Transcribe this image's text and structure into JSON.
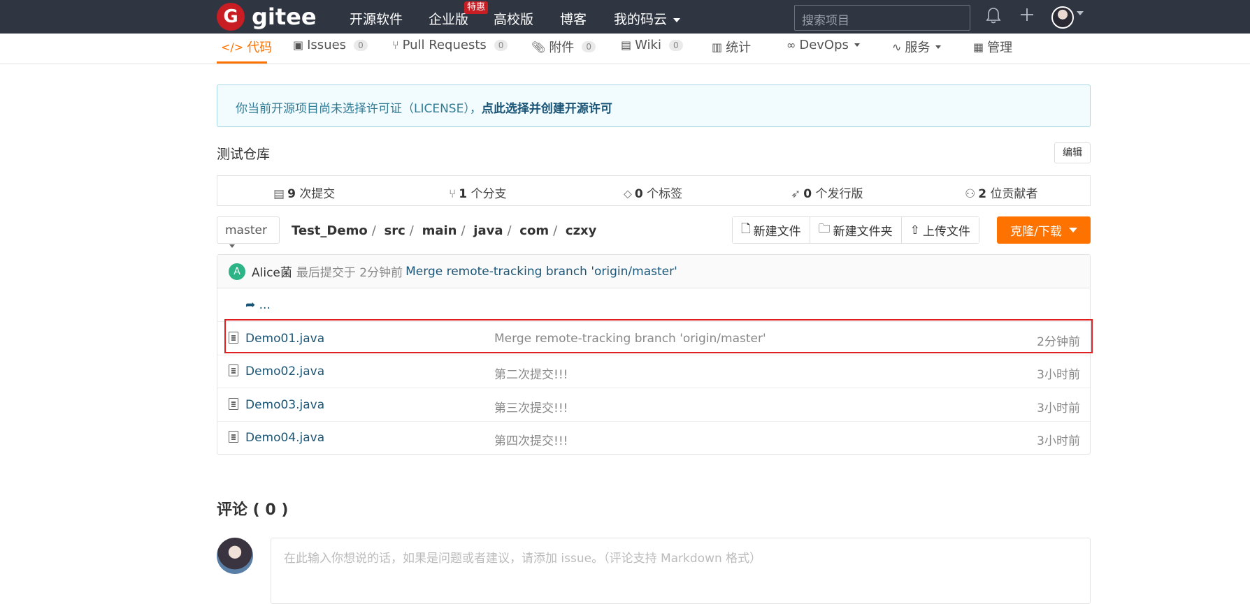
{
  "brand": {
    "logo_letter": "G",
    "name": "gitee"
  },
  "topnav": {
    "items": [
      "开源软件",
      "企业版",
      "高校版",
      "博客",
      "我的码云"
    ],
    "badge": "特惠",
    "search_placeholder": "搜索项目"
  },
  "tabs": [
    {
      "label": "代码",
      "icon": "code-icon",
      "active": true
    },
    {
      "label": "Issues",
      "count": "0",
      "icon": "issue-icon"
    },
    {
      "label": "Pull Requests",
      "count": "0",
      "icon": "pull-request-icon"
    },
    {
      "label": "附件",
      "count": "0",
      "icon": "paperclip-icon"
    },
    {
      "label": "Wiki",
      "count": "0",
      "icon": "book-icon"
    },
    {
      "label": "统计",
      "icon": "bar-chart-icon"
    },
    {
      "label": "DevOps",
      "icon": "infinity-icon"
    },
    {
      "label": "服务",
      "icon": "pulse-icon"
    },
    {
      "label": "管理",
      "icon": "settings-doc-icon"
    }
  ],
  "notice": {
    "text": "你当前开源项目尚未选择许可证（LICENSE），",
    "link": "点此选择并创建开源许可"
  },
  "repo": {
    "description": "测试仓库",
    "edit_label": "编辑"
  },
  "stats": [
    {
      "num": "9",
      "label": "次提交",
      "icon": "commit-icon"
    },
    {
      "num": "1",
      "label": "个分支",
      "icon": "branch-icon"
    },
    {
      "num": "0",
      "label": "个标签",
      "icon": "tag-icon"
    },
    {
      "num": "0",
      "label": "个发行版",
      "icon": "release-icon"
    },
    {
      "num": "2",
      "label": "位贡献者",
      "icon": "contributors-icon"
    }
  ],
  "branch": {
    "name": "master"
  },
  "path": [
    "Test_Demo",
    "src",
    "main",
    "java",
    "com",
    "czxy"
  ],
  "actions": {
    "new_file": "新建文件",
    "new_folder": "新建文件夹",
    "upload": "上传文件",
    "clone": "克隆/下载"
  },
  "last_commit": {
    "avatar_letter": "A",
    "author": "Alice菌",
    "meta": "最后提交于 2分钟前",
    "message": "Merge remote-tracking branch 'origin/master'"
  },
  "back_link": "...",
  "files": [
    {
      "name": "Demo01.java",
      "message": "Merge remote-tracking branch 'origin/master'",
      "time": "2分钟前"
    },
    {
      "name": "Demo02.java",
      "message": "第二次提交!!!",
      "time": "3小时前"
    },
    {
      "name": "Demo03.java",
      "message": "第三次提交!!!",
      "time": "3小时前"
    },
    {
      "name": "Demo04.java",
      "message": "第四次提交!!!",
      "time": "3小时前"
    }
  ],
  "comments": {
    "title": "评论 ( 0 )",
    "placeholder": "在此输入你想说的话，如果是问题或者建议，请添加 issue。（评论支持 Markdown 格式）"
  },
  "colors": {
    "accent": "#fe7300",
    "topbar": "#2f3642",
    "link": "#1a5577",
    "highlight": "#e02020"
  }
}
